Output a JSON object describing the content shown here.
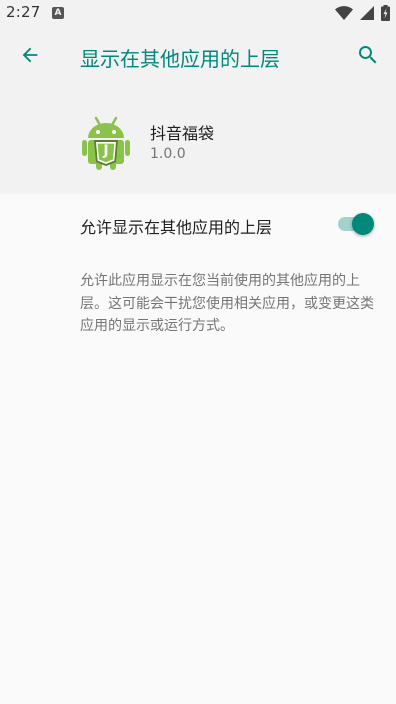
{
  "status_bar": {
    "time": "2:27",
    "notification_icon": "A",
    "icons": [
      "wifi-icon",
      "cellular-signal-icon",
      "battery-charging-icon"
    ]
  },
  "app_bar": {
    "title": "显示在其他应用的上层",
    "back_icon": "arrow-left-icon",
    "search_icon": "search-icon"
  },
  "app": {
    "name": "抖音福袋",
    "version": "1.0.0",
    "icon": "android-app-icon",
    "icon_letter": "J"
  },
  "setting": {
    "label": "允许显示在其他应用的上层",
    "enabled": true,
    "description": "允许此应用显示在您当前使用的其他应用的上层。这可能会干扰您使用相关应用，或变更这类应用的显示或运行方式。"
  },
  "colors": {
    "accent": "#00897b",
    "toggle_track": "#9fd3cc",
    "android_green": "#8bc34a"
  }
}
